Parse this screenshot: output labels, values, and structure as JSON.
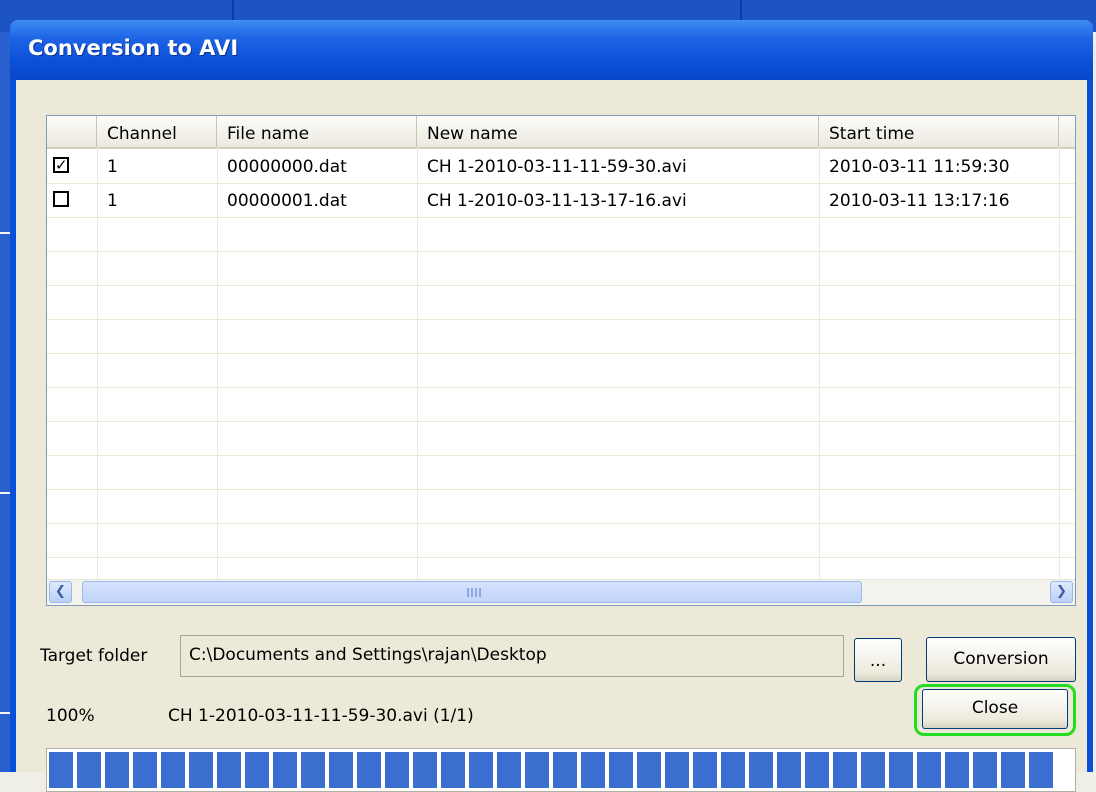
{
  "window": {
    "title": "Conversion to AVI"
  },
  "list": {
    "columns": [
      "",
      "Channel",
      "File name",
      "New name",
      "Start time"
    ],
    "rows": [
      {
        "checked": true,
        "channel": "1",
        "file": "00000000.dat",
        "new_name": "CH 1-2010-03-11-11-59-30.avi",
        "start": "2010-03-11 11:59:30"
      },
      {
        "checked": false,
        "channel": "1",
        "file": "00000001.dat",
        "new_name": "CH 1-2010-03-11-13-17-16.avi",
        "start": "2010-03-11 13:17:16"
      }
    ],
    "scroll_left_icon": "chevron-left-icon",
    "scroll_right_icon": "chevron-right-icon"
  },
  "target": {
    "label": "Target folder",
    "path": "C:\\Documents and Settings\\rajan\\Desktop",
    "browse_label": "...",
    "convert_label": "Conversion"
  },
  "status": {
    "percent": "100%",
    "file": "CH 1-2010-03-11-11-59-30.avi (1/1)",
    "progress": 1.0
  },
  "close_label": "Close",
  "colors": {
    "title_bar": "#0a50d8",
    "progress": "#3a6fd0",
    "highlight": "#22dd22"
  }
}
